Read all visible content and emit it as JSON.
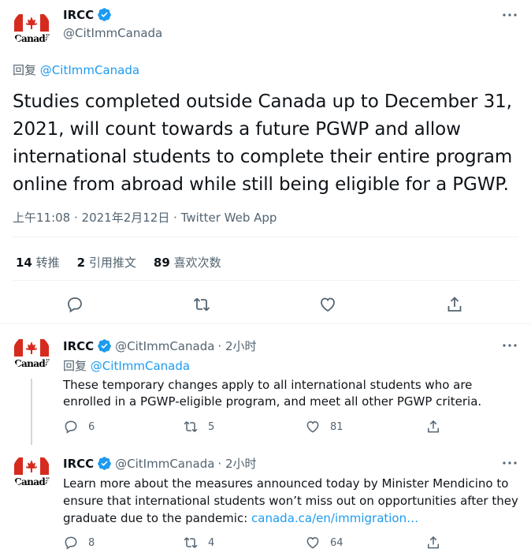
{
  "main_tweet": {
    "name": "IRCC",
    "handle": "@CitImmCanada",
    "avatar_word": "Canadä",
    "reply_prefix": "回复",
    "reply_to": "@CitImmCanada",
    "text": "Studies completed outside Canada up to December 31, 2021, will count towards a future PGWP and allow international students to complete their entire program online from abroad while still being eligible for a PGWP.",
    "timestamp": "上午11:08 · 2021年2月12日 · Twitter Web App",
    "stats": {
      "retweets_count": "14",
      "retweets_label": "转推",
      "quotes_count": "2",
      "quotes_label": "引用推文",
      "likes_count": "89",
      "likes_label": "喜欢次数"
    }
  },
  "replies": [
    {
      "name": "IRCC",
      "handle": "@CitImmCanada",
      "time": "· 2小时",
      "avatar_word": "Canadä",
      "reply_prefix": "回复",
      "reply_to": "@CitImmCanada",
      "text": "These temporary changes apply to all international students who are enrolled in a PGWP-eligible program, and meet all other PGWP criteria.",
      "link": "",
      "reply_count": "6",
      "retweet_count": "5",
      "like_count": "81"
    },
    {
      "name": "IRCC",
      "handle": "@CitImmCanada",
      "time": "· 2小时",
      "avatar_word": "Canadä",
      "text": "Learn more about the measures announced today by Minister Mendicino to ensure that international students won’t miss out on opportunities after they graduate due to the pandemic: ",
      "link": "canada.ca/en/immigration…",
      "reply_count": "8",
      "retweet_count": "4",
      "like_count": "64"
    }
  ],
  "colors": {
    "accent": "#1d9bf0",
    "text": "#0f1419",
    "secondary": "#536471",
    "border": "#eff3f4",
    "flag_red": "#d52b1e"
  }
}
